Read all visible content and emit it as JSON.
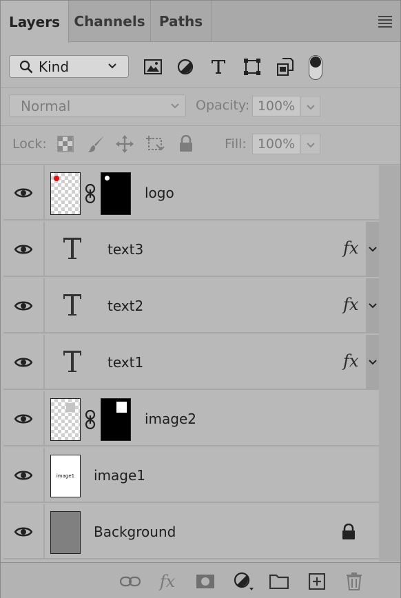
{
  "tabs": [
    {
      "label": "Layers",
      "active": true
    },
    {
      "label": "Channels",
      "active": false
    },
    {
      "label": "Paths",
      "active": false
    }
  ],
  "filter": {
    "kind_label": "Kind",
    "icons": [
      "pixel-filter-icon",
      "adjustment-filter-icon",
      "type-filter-icon",
      "shape-filter-icon",
      "smart-object-filter-icon",
      "filter-toggle"
    ]
  },
  "blend": {
    "mode": "Normal",
    "opacity_label": "Opacity:",
    "opacity_value": "100%"
  },
  "lock": {
    "label": "Lock:",
    "fill_label": "Fill:",
    "fill_value": "100%",
    "icons": [
      "lock-transparent-icon",
      "lock-paint-icon",
      "lock-position-icon",
      "lock-artboard-icon",
      "lock-all-icon"
    ]
  },
  "layers": [
    {
      "name": "logo",
      "type": "smart-with-mask",
      "fx": false
    },
    {
      "name": "text3",
      "type": "text",
      "fx": true,
      "fx_label": "fx"
    },
    {
      "name": "text2",
      "type": "text",
      "fx": true,
      "fx_label": "fx"
    },
    {
      "name": "text1",
      "type": "text",
      "fx": true,
      "fx_label": "fx"
    },
    {
      "name": "image2",
      "type": "smart-with-mask",
      "fx": false
    },
    {
      "name": "image1",
      "type": "image",
      "fx": false,
      "thumb_text": "image1"
    },
    {
      "name": "Background",
      "type": "background",
      "fx": false,
      "locked": true
    }
  ],
  "bottom": {
    "fx_label": "fx",
    "icons": [
      "link-layers-icon",
      "add-style-icon",
      "add-mask-icon",
      "adjustment-layer-icon",
      "new-group-icon",
      "new-layer-icon",
      "delete-icon"
    ]
  },
  "colors": {
    "panel_bg": "#b8b8b8",
    "tab_bg": "#a9a9a9",
    "logo_dot": "#e01010",
    "background_swatch": "#808080"
  }
}
